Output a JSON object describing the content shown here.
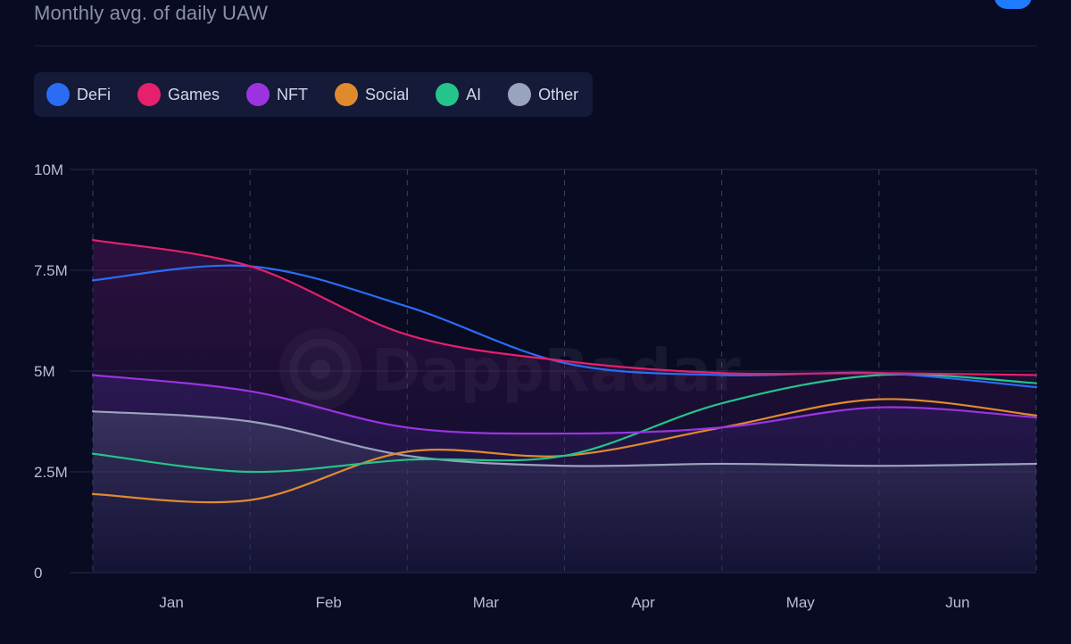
{
  "header": {
    "subtitle": "Monthly avg. of daily UAW"
  },
  "watermark": "DappRadar",
  "chart_data": {
    "type": "line",
    "x": [
      "Jan",
      "Feb",
      "Mar",
      "Apr",
      "May",
      "Jun"
    ],
    "ylim": [
      0,
      10000000
    ],
    "yticks": [
      {
        "value": 0,
        "label": "0"
      },
      {
        "value": 2500000,
        "label": "2.5M"
      },
      {
        "value": 5000000,
        "label": "5M"
      },
      {
        "value": 7500000,
        "label": "7.5M"
      },
      {
        "value": 10000000,
        "label": "10M"
      }
    ],
    "legend_position": "top-left",
    "grid": true,
    "series": [
      {
        "name": "DeFi",
        "color": "#2a6df4",
        "values": [
          7250000.0,
          7600000.0,
          6600000.0,
          5200000.0,
          4900000.0,
          4950000.0,
          4600000.0
        ]
      },
      {
        "name": "Games",
        "color": "#e5206c",
        "values": [
          8250000.0,
          7600000.0,
          5900000.0,
          5250000.0,
          4950000.0,
          4950000.0,
          4900000.0
        ]
      },
      {
        "name": "NFT",
        "color": "#9b34e0",
        "values": [
          4900000.0,
          4500000.0,
          3600000.0,
          3450000.0,
          3600000.0,
          4100000.0,
          3850000.0
        ]
      },
      {
        "name": "Social",
        "color": "#e08a2e",
        "values": [
          1950000.0,
          1800000.0,
          3000000.0,
          2900000.0,
          3600000.0,
          4300000.0,
          3900000.0
        ]
      },
      {
        "name": "AI",
        "color": "#24c48a",
        "values": [
          2950000.0,
          2500000.0,
          2800000.0,
          2900000.0,
          4200000.0,
          4900000.0,
          4700000.0
        ]
      },
      {
        "name": "Other",
        "color": "#9aa3bd",
        "values": [
          4000000.0,
          3750000.0,
          2900000.0,
          2650000.0,
          2700000.0,
          2650000.0,
          2700000.0
        ]
      }
    ]
  }
}
